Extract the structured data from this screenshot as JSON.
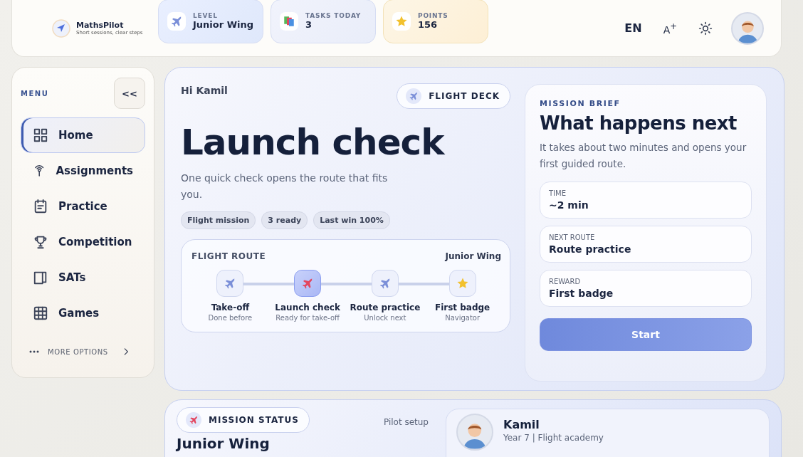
{
  "brand": {
    "name": "MathsPilot",
    "tagline": "Short sessions, clear steps"
  },
  "stats": [
    {
      "kind": "level",
      "label": "LEVEL",
      "value": "Junior Wing"
    },
    {
      "kind": "tasks",
      "label": "TASKS TODAY",
      "value": "3"
    },
    {
      "kind": "points",
      "label": "POINTS",
      "value": "156"
    }
  ],
  "header_actions": {
    "language": "EN",
    "text_size": "A$^{+}$"
  },
  "sidebar": {
    "title": "MENU",
    "collapse": "<<",
    "items": [
      {
        "label": "Home",
        "selected": true
      },
      {
        "label": "Assignments",
        "selected": false
      },
      {
        "label": "Practice",
        "selected": false
      },
      {
        "label": "Competition",
        "selected": false
      },
      {
        "label": "SATs",
        "selected": false
      },
      {
        "label": "Games",
        "selected": false
      }
    ],
    "more": "MORE OPTIONS"
  },
  "hero": {
    "greeting": "Hi Kamil",
    "badge": "FLIGHT DECK",
    "title": "Launch check",
    "subtitle": "One quick check opens the route that fits you.",
    "tags": [
      "Flight mission",
      "3 ready",
      "Last win 100%"
    ],
    "route": {
      "title": "FLIGHT ROUTE",
      "level": "Junior Wing",
      "steps": [
        {
          "kind": "flight",
          "name": "Take-off",
          "note": "Done before",
          "selected": false
        },
        {
          "kind": "flight",
          "name": "Launch check",
          "note": "Ready for take-off",
          "selected": true
        },
        {
          "kind": "flight",
          "name": "Route practice",
          "note": "Unlock next",
          "selected": false
        },
        {
          "kind": "badge",
          "name": "First badge",
          "note": "Navigator",
          "selected": false
        }
      ]
    }
  },
  "brief": {
    "eyebrow": "MISSION BRIEF",
    "title": "What happens next",
    "text": "It takes about two minutes and opens your first guided route.",
    "rows": [
      {
        "label": "TIME",
        "value": "~2 min"
      },
      {
        "label": "NEXT ROUTE",
        "value": "Route practice"
      },
      {
        "label": "REWARD",
        "value": "First badge"
      }
    ],
    "button": "Start"
  },
  "status": {
    "badge": "MISSION STATUS",
    "link": "Pilot setup",
    "title": "Junior Wing",
    "profile": {
      "name": "Kamil",
      "detail": "Year 7 | Flight academy"
    }
  }
}
